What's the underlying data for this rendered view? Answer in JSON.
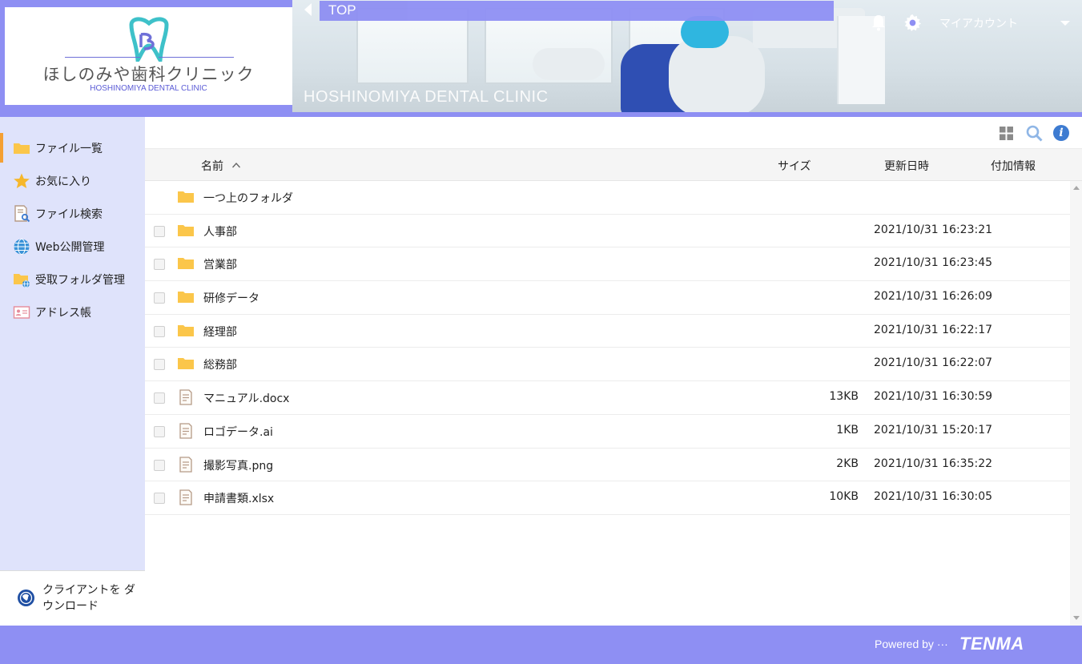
{
  "header": {
    "logo_name": "ほしのみや歯科クリニック",
    "logo_sub": "HOSHINOMIYA DENTAL CLINIC",
    "banner_caption": "HOSHINOMIYA DENTAL CLINIC",
    "breadcrumb": "TOP",
    "account_label": "マイアカウント",
    "icons": [
      "back-arrow-icon",
      "bell-icon",
      "gear-icon",
      "chevron-down-icon"
    ]
  },
  "sidebar": {
    "items": [
      {
        "label": "ファイル一覧",
        "icon": "folder-icon",
        "active": true
      },
      {
        "label": "お気に入り",
        "icon": "star-icon"
      },
      {
        "label": "ファイル検索",
        "icon": "file-search-icon"
      },
      {
        "label": "Web公開管理",
        "icon": "globe-icon"
      },
      {
        "label": "受取フォルダ管理",
        "icon": "receive-folder-icon"
      },
      {
        "label": "アドレス帳",
        "icon": "address-book-icon"
      }
    ],
    "download_label": "クライアントを ダウンロード"
  },
  "toolbar": {
    "icons": [
      "grid-view-icon",
      "search-icon",
      "info-icon"
    ],
    "info_glyph": "i"
  },
  "table": {
    "headers": {
      "name": "名前",
      "size": "サイズ",
      "date": "更新日時",
      "info": "付加情報"
    },
    "sort": "name-ascending",
    "rows": [
      {
        "name": "一つ上のフォルダ",
        "type": "parent",
        "size": "",
        "date": ""
      },
      {
        "name": "人事部",
        "type": "folder",
        "size": "",
        "date": "2021/10/31 16:23:21"
      },
      {
        "name": "営業部",
        "type": "folder",
        "size": "",
        "date": "2021/10/31 16:23:45"
      },
      {
        "name": "研修データ",
        "type": "folder",
        "size": "",
        "date": "2021/10/31 16:26:09"
      },
      {
        "name": "経理部",
        "type": "folder",
        "size": "",
        "date": "2021/10/31 16:22:17"
      },
      {
        "name": "総務部",
        "type": "folder",
        "size": "",
        "date": "2021/10/31 16:22:07"
      },
      {
        "name": "マニュアル.docx",
        "type": "file",
        "size": "13KB",
        "date": "2021/10/31 16:30:59"
      },
      {
        "name": "ロゴデータ.ai",
        "type": "file",
        "size": "1KB",
        "date": "2021/10/31 15:20:17"
      },
      {
        "name": "撮影写真.png",
        "type": "file",
        "size": "2KB",
        "date": "2021/10/31 16:35:22"
      },
      {
        "name": "申請書類.xlsx",
        "type": "file",
        "size": "10KB",
        "date": "2021/10/31 16:30:05"
      }
    ]
  },
  "footer": {
    "powered": "Powered by ···",
    "brand": "TENMA"
  },
  "colors": {
    "accent": "#8e8ff3",
    "sidebar_bg": "#dfe3fb",
    "active_marker": "#f4a034",
    "folder": "#fbc64a",
    "info": "#3d7bd1"
  }
}
